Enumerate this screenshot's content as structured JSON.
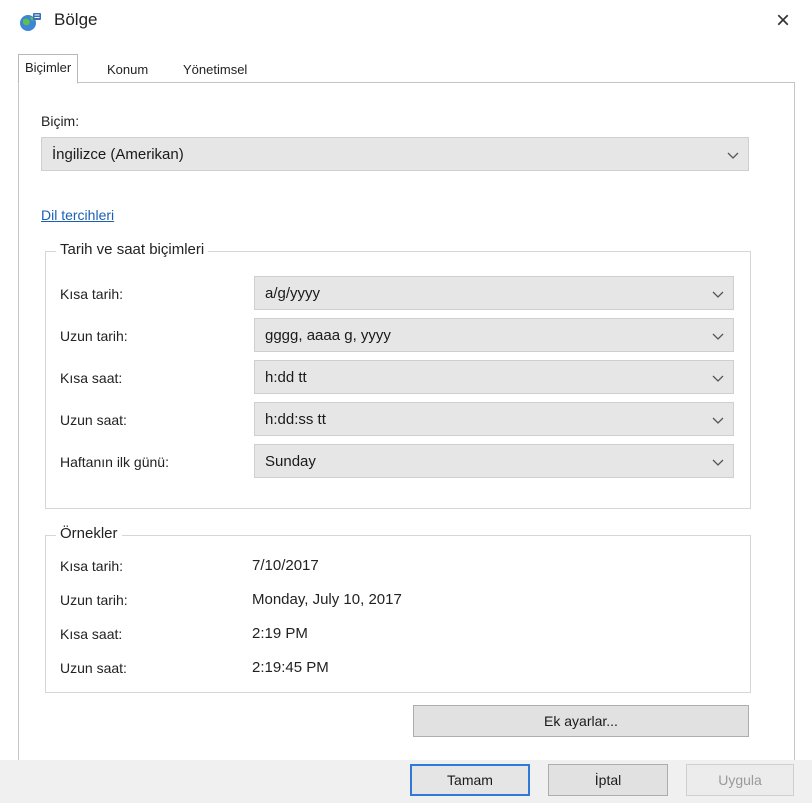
{
  "window": {
    "title": "Bölge",
    "close_glyph": "×",
    "icon": "globe-icon"
  },
  "tabs": [
    {
      "label": "Biçimler",
      "active": true
    },
    {
      "label": "Konum",
      "active": false
    },
    {
      "label": "Yönetimsel",
      "active": false
    }
  ],
  "format": {
    "label": "Biçim:",
    "value": "İngilizce (Amerikan)"
  },
  "language_link": "Dil tercihleri",
  "datetime_group": {
    "title": "Tarih ve saat biçimleri",
    "rows": [
      {
        "label": "Kısa tarih:",
        "value": "a/g/yyyy"
      },
      {
        "label": "Uzun tarih:",
        "value": "gggg, aaaa g, yyyy"
      },
      {
        "label": "Kısa saat:",
        "value": "h:dd tt"
      },
      {
        "label": "Uzun saat:",
        "value": "h:dd:ss tt"
      },
      {
        "label": "Haftanın ilk günü:",
        "value": "Sunday"
      }
    ]
  },
  "examples": {
    "title": "Örnekler",
    "rows": [
      {
        "label": "Kısa tarih:",
        "value": "7/10/2017"
      },
      {
        "label": "Uzun tarih:",
        "value": "Monday, July 10, 2017"
      },
      {
        "label": "Kısa saat:",
        "value": "2:19 PM"
      },
      {
        "label": "Uzun saat:",
        "value": "2:19:45 PM"
      }
    ]
  },
  "buttons": {
    "additional": "Ek ayarlar...",
    "ok": "Tamam",
    "cancel": "İptal",
    "apply": "Uygula"
  },
  "colors": {
    "link": "#1a5fb4",
    "primary_border": "#2f7ad6"
  }
}
